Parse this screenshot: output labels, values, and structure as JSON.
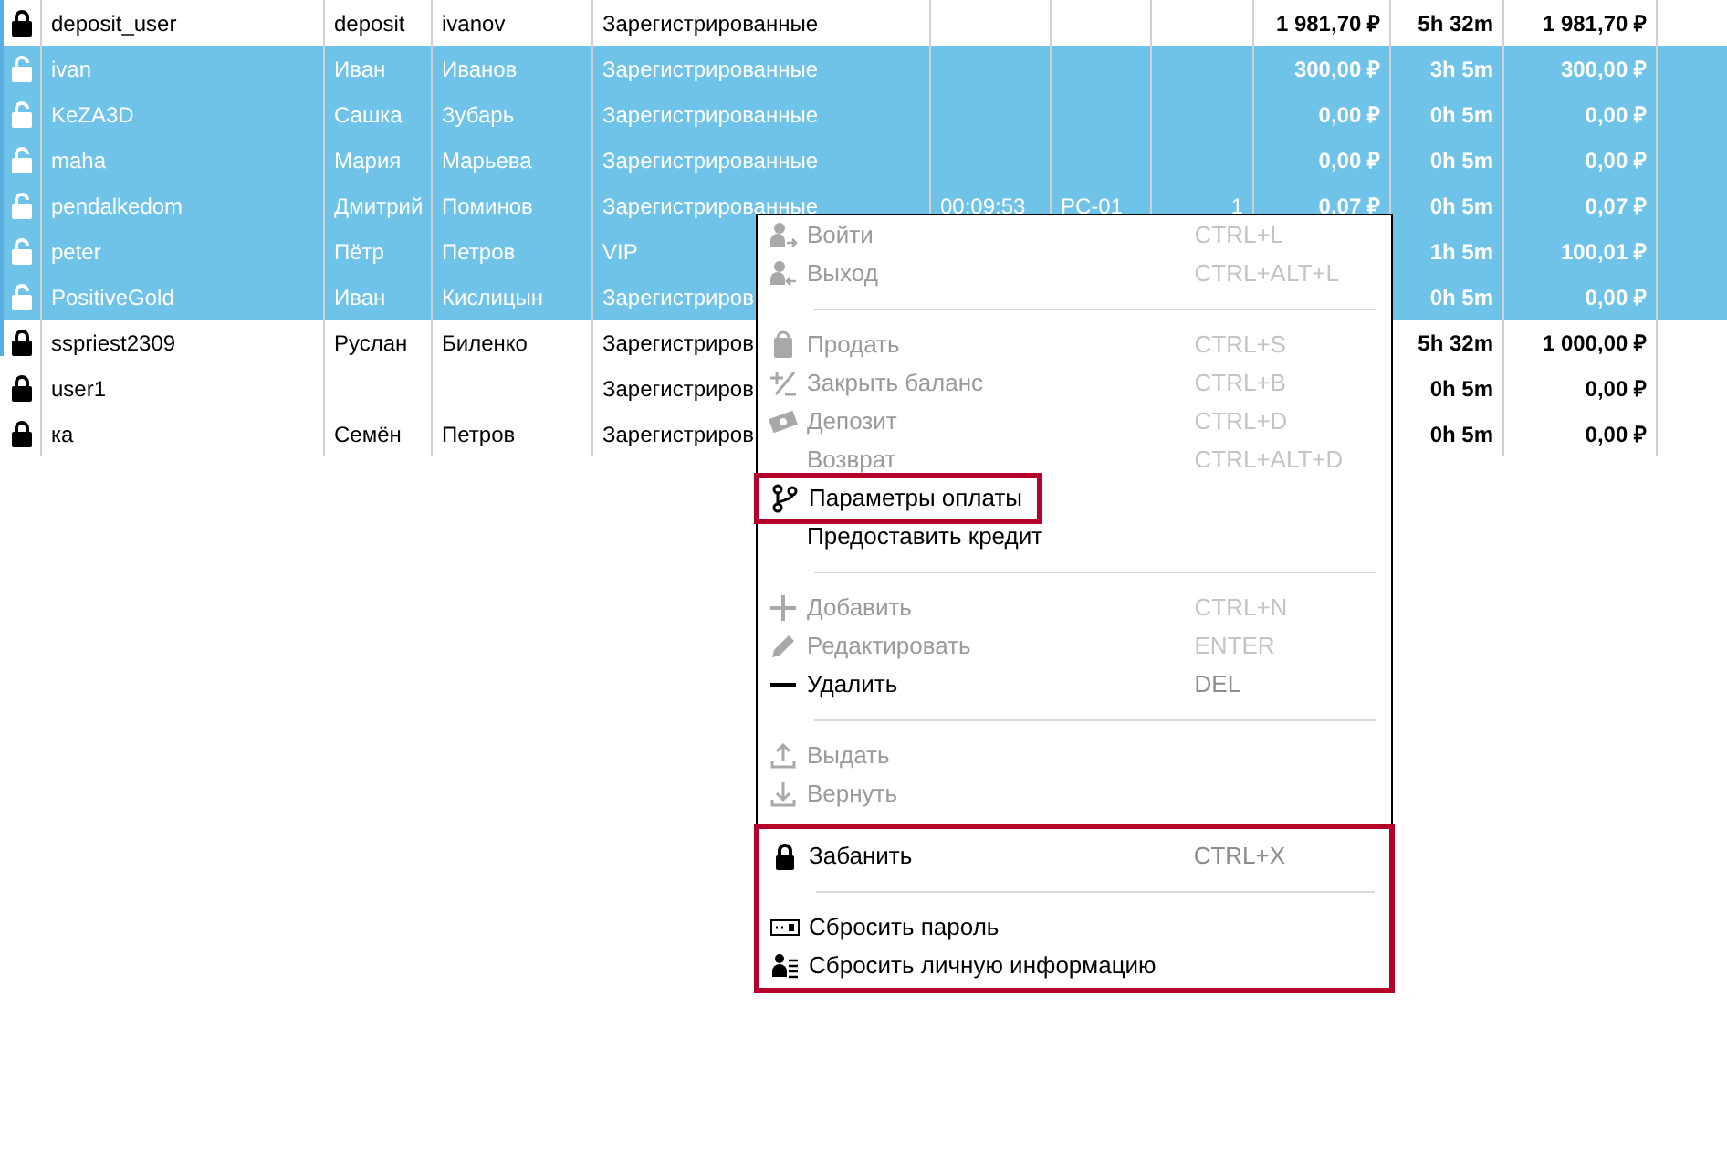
{
  "table": {
    "rows": [
      {
        "locked": true,
        "selected": false,
        "cells": [
          "deposit_user",
          "deposit",
          "ivanov",
          "Зарегистрированные",
          null,
          null,
          null,
          "1 981,70 ₽",
          "5h 32m",
          "1 981,70 ₽"
        ]
      },
      {
        "locked": false,
        "selected": true,
        "cells": [
          "ivan",
          "Иван",
          "Иванов",
          "Зарегистрированные",
          null,
          null,
          null,
          "300,00 ₽",
          "3h 5m",
          "300,00 ₽"
        ]
      },
      {
        "locked": false,
        "selected": true,
        "cells": [
          "KeZA3D",
          "Сашка",
          "Зубарь",
          "Зарегистрированные",
          null,
          null,
          null,
          "0,00 ₽",
          "0h 5m",
          "0,00 ₽"
        ]
      },
      {
        "locked": false,
        "selected": true,
        "cells": [
          "maha",
          "Мария",
          "Марьева",
          "Зарегистрированные",
          null,
          null,
          null,
          "0,00 ₽",
          "0h 5m",
          "0,00 ₽"
        ]
      },
      {
        "locked": false,
        "selected": true,
        "cells": [
          "pendalkedom",
          "Дмитрий",
          "Поминов",
          "Зарегистрированные",
          "00:09:53",
          "PC-01",
          "1",
          "0,07 ₽",
          "0h 5m",
          "0,07 ₽"
        ]
      },
      {
        "locked": false,
        "selected": true,
        "cells": [
          "peter",
          "Пётр",
          "Петров",
          "VIP",
          null,
          null,
          null,
          null,
          "1h 5m",
          "100,01 ₽"
        ]
      },
      {
        "locked": false,
        "selected": true,
        "cells": [
          "PositiveGold",
          "Иван",
          "Кислицын",
          "Зарегистриров",
          null,
          null,
          null,
          null,
          "0h 5m",
          "0,00 ₽"
        ]
      },
      {
        "locked": true,
        "selected": false,
        "cells": [
          "sspriest2309",
          "Руслан",
          "Биленко",
          "Зарегистриров",
          null,
          null,
          null,
          null,
          "5h 32m",
          "1 000,00 ₽"
        ]
      },
      {
        "locked": true,
        "selected": false,
        "cells": [
          "user1",
          null,
          null,
          "Зарегистриров",
          null,
          null,
          null,
          null,
          "0h 5m",
          "0,00 ₽"
        ]
      },
      {
        "locked": true,
        "selected": false,
        "cells": [
          "ка",
          "Семён",
          "Петров",
          "Зарегистриров",
          null,
          null,
          null,
          null,
          "0h 5m",
          "0,00 ₽"
        ]
      }
    ]
  },
  "context_menu": {
    "sections": [
      {
        "highlighted": false,
        "items": [
          {
            "kind": "item",
            "label": "Войти",
            "shortcut": "CTRL+L",
            "disabled": true,
            "highlighted": false
          },
          {
            "kind": "item",
            "label": "Выход",
            "shortcut": "CTRL+ALT+L",
            "disabled": true,
            "highlighted": false
          },
          {
            "kind": "separator"
          },
          {
            "kind": "item",
            "label": "Продать",
            "shortcut": "CTRL+S",
            "disabled": true,
            "highlighted": false
          },
          {
            "kind": "item",
            "label": "Закрыть баланс",
            "shortcut": "CTRL+B",
            "disabled": true,
            "highlighted": false
          },
          {
            "kind": "item",
            "label": "Депозит",
            "shortcut": "CTRL+D",
            "disabled": true,
            "highlighted": false
          },
          {
            "kind": "item",
            "label": "Возврат",
            "shortcut": "CTRL+ALT+D",
            "disabled": true,
            "highlighted": false
          },
          {
            "kind": "item",
            "label": "Параметры оплаты",
            "disabled": false,
            "highlighted": true
          },
          {
            "kind": "item",
            "label": "Предоставить кредит",
            "disabled": false,
            "highlighted": false
          },
          {
            "kind": "separator"
          },
          {
            "kind": "item",
            "label": "Добавить",
            "shortcut": "CTRL+N",
            "disabled": true,
            "highlighted": false
          },
          {
            "kind": "item",
            "label": "Редактировать",
            "shortcut": "ENTER",
            "disabled": true,
            "highlighted": false
          },
          {
            "kind": "item",
            "label": "Удалить",
            "shortcut": "DEL",
            "disabled": false,
            "highlighted": false
          },
          {
            "kind": "separator"
          },
          {
            "kind": "item",
            "label": "Выдать",
            "disabled": true,
            "highlighted": false
          },
          {
            "kind": "item",
            "label": "Вернуть",
            "disabled": true,
            "highlighted": false
          }
        ]
      },
      {
        "highlighted": true,
        "items": [
          {
            "kind": "item",
            "label": "Забанить",
            "shortcut": "CTRL+X",
            "disabled": false,
            "highlighted": false
          },
          {
            "kind": "separator"
          },
          {
            "kind": "item",
            "label": "Сбросить пароль",
            "disabled": false,
            "highlighted": false
          },
          {
            "kind": "item",
            "label": "Сбросить личную информацию",
            "disabled": false,
            "highlighted": false
          }
        ]
      }
    ]
  }
}
